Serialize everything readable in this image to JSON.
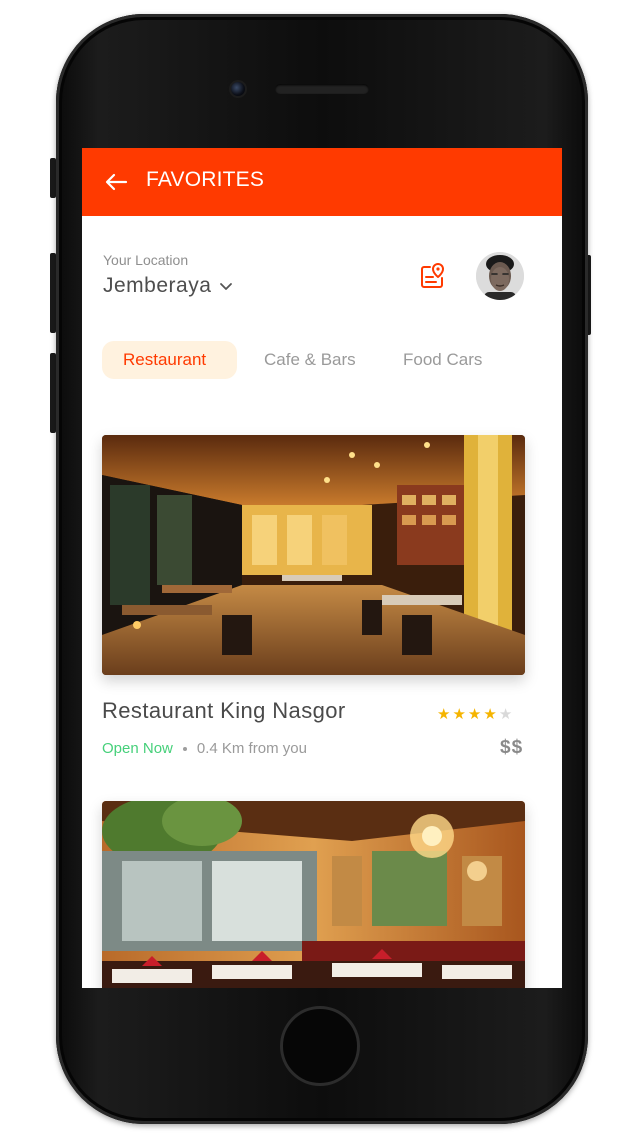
{
  "app_bar": {
    "title": "FAVORITES",
    "back_icon": "arrow-left-icon",
    "background": "#ff3a00"
  },
  "location": {
    "label": "Your Location",
    "value": "Jemberaya",
    "dropdown_icon": "chevron-down-icon",
    "map_icon": "map-pin-icon"
  },
  "tabs": [
    {
      "label": "Restaurant",
      "active": true
    },
    {
      "label": "Cafe & Bars",
      "active": false
    },
    {
      "label": "Food Cars",
      "active": false
    }
  ],
  "colors": {
    "accent": "#ff3a00",
    "active_tab_bg": "#fff2df",
    "open_status": "#46d07a",
    "star": "#f5b400"
  },
  "cards": [
    {
      "name": "Restaurant King Nasgor",
      "rating": 4,
      "rating_max": 5,
      "status": "Open Now",
      "distance": "0.4 Km from you",
      "price": "$$"
    },
    {
      "name": "",
      "rating": null,
      "status": "",
      "distance": "",
      "price": ""
    }
  ]
}
